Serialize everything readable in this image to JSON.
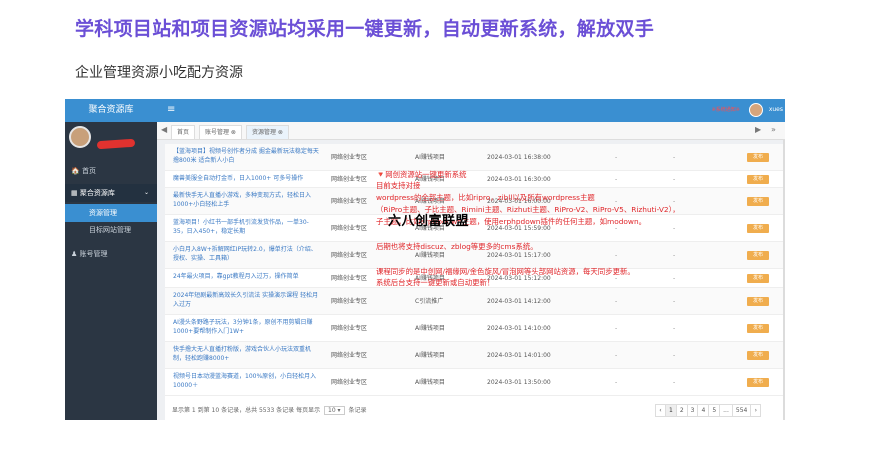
{
  "heading": "学科项目站和项目资源站均采用一键更新，自动更新系统，解放双手",
  "subheading": "企业管理资源小吃配方资源",
  "app": {
    "logo": "聚合资源库",
    "top_red_text": "※系统通知※",
    "user": "xues",
    "sidebar": {
      "home": "首页",
      "group": "聚合资源库",
      "item_active": "资源管理",
      "item2": "目标网站管理",
      "item3": "账号管理"
    },
    "tabs": [
      "首页",
      "账号管理 ⊗",
      "资源管理 ⊗"
    ],
    "tab_prev": "◀",
    "tab_next": "▶",
    "tab_more": "»",
    "rows": [
      {
        "title": "【蓝海项目】视频号创作者分成 掘金最新玩法稳定每天撸800米 适合新人小白",
        "cat": "网络创业专区",
        "type": "AI赚钱项目",
        "time": "2024-03-01 16:38:00",
        "d1": "-",
        "d2": "-",
        "btn": "发布"
      },
      {
        "title": "魔兽美服全自动打金币，日入1000+ 可多号操作",
        "cat": "网络创业专区",
        "type": "AI赚钱项目",
        "time": "2024-03-01 16:30:00",
        "d1": "-",
        "d2": "-",
        "btn": "发布"
      },
      {
        "title": "最新快手无人直播小游戏，多种变现方式，轻松日入1000+小白轻松上手",
        "cat": "网络创业专区",
        "type": "AI赚钱项目",
        "time": "2024-03-01 16:00:00",
        "d1": "-",
        "d2": "-",
        "btn": "发布"
      },
      {
        "title": "蓝海项目！小红书一部手机引流发货作品，一单30-35，日入450+，稳定长期",
        "cat": "网络创业专区",
        "type": "AI赚钱项目",
        "time": "2024-03-01 15:59:00",
        "d1": "-",
        "d2": "-",
        "btn": "发布"
      },
      {
        "title": "小白月入8W+拆解网红IP玩转2.0，爆单打法（介绍、授权、实操、工具箱）",
        "cat": "网络创业专区",
        "type": "AI赚钱项目",
        "time": "2024-03-01 15:17:00",
        "d1": "-",
        "d2": "-",
        "btn": "发布"
      },
      {
        "title": "24年最火项目，靠gpt教程月入过万，操作简单",
        "cat": "网络创业专区",
        "type": "AI赚钱项目",
        "time": "2024-03-01 15:12:00",
        "d1": "-",
        "d2": "-",
        "btn": "发布"
      },
      {
        "title": "2024年短剧最新高效长久引流法 实操演示课程 轻松月入过万",
        "cat": "网络创业专区",
        "type": "C引流推广",
        "time": "2024-03-01 14:12:00",
        "d1": "-",
        "d2": "-",
        "btn": "发布"
      },
      {
        "title": "AI漫头条野路子玩法，3分钟1条，原创不用剪辑日赚1000+要帮制作入门1W+",
        "cat": "网络创业专区",
        "type": "AI赚钱项目",
        "time": "2024-03-01 14:10:00",
        "d1": "-",
        "d2": "-",
        "btn": "发布"
      },
      {
        "title": "快手撸大无人直播打粉版，游戏合伙人小玩法双重机制，轻松跑赚8000+",
        "cat": "网络创业专区",
        "type": "AI赚钱项目",
        "time": "2024-03-01 14:01:00",
        "d1": "-",
        "d2": "-",
        "btn": "发布"
      },
      {
        "title": "视频号日本动漫蓝海赛道，100%原创，小白轻松月入10000＋",
        "cat": "网络创业专区",
        "type": "AI赚钱项目",
        "time": "2024-03-01 13:50:00",
        "d1": "-",
        "d2": "-",
        "btn": "发布"
      }
    ],
    "footer": {
      "prefix": "显示第 1 到第 10 条记录，总共 5533 条记录 每页显示",
      "page_size": "10 ▾",
      "suffix": "条记录"
    },
    "pager": [
      "‹",
      "1",
      "2",
      "3",
      "4",
      "5",
      "...",
      "554",
      "›"
    ]
  },
  "overlay": {
    "lines": [
      "🔻网创资源站一键更新系统",
      "目前支持对接",
      "wordpress的全部主题，比如ripro，zibll以及所有wordpress主题",
      "（RiPro主题、子比主题、Rimini主题、Rizhuti主题、RiPro-V2、RiPro-V5、Rizhuti-V2），",
      "子主题，比如erphpdown主题，使用erphpdown插件的任何主题，如modown。",
      "后期也将支持discuz、zblog等更多的cms系统。",
      "课程同步的是中创网/福缘网/金色旋风/冒泡网等头部网站资源，每天同步更新。",
      "系统后台支持一键更新或自动更新！"
    ],
    "big": "六八创富联盟"
  },
  "colors": {
    "heading": "#6b4fd6",
    "accent": "#3a8fd1",
    "overlay_red": "#e0262a",
    "publish": "#f0ad4e"
  }
}
